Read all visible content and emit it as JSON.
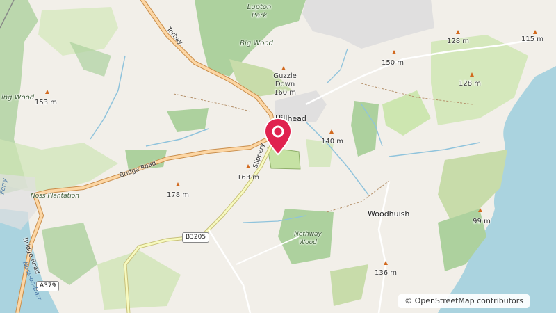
{
  "map": {
    "attribution": "© OpenStreetMap contributors",
    "place_names": {
      "hillhead": "Hillhead",
      "woodhuish": "Woodhuish"
    },
    "woods": {
      "lupton_park": "Lupton Park",
      "big_wood": "Big Wood",
      "guzzle_down": "Guzzle Down",
      "ing_wood": "ing Wood",
      "noss_plantation": "Noss Plantation",
      "nethway_wood": "Nethway Wood"
    },
    "elevations": {
      "e115": "115 m",
      "e128a": "128 m",
      "e150": "150 m",
      "e128b": "128 m",
      "e160": "160 m",
      "e153": "153 m",
      "e140": "140 m",
      "e163": "163 m",
      "e178": "178 m",
      "e99": "99 m",
      "e136": "136 m"
    },
    "roads": {
      "torbay": "Torbay",
      "slippery": "Slippery",
      "bridge_road_main": "Bridge Road",
      "bridge_road_west": "Bridge Road",
      "b3205": "B3205",
      "a379": "A379",
      "ferry": "Ferry",
      "noss_on_dart": "Noss-on-Dart"
    },
    "marker": {
      "color": "#e0224f"
    }
  }
}
